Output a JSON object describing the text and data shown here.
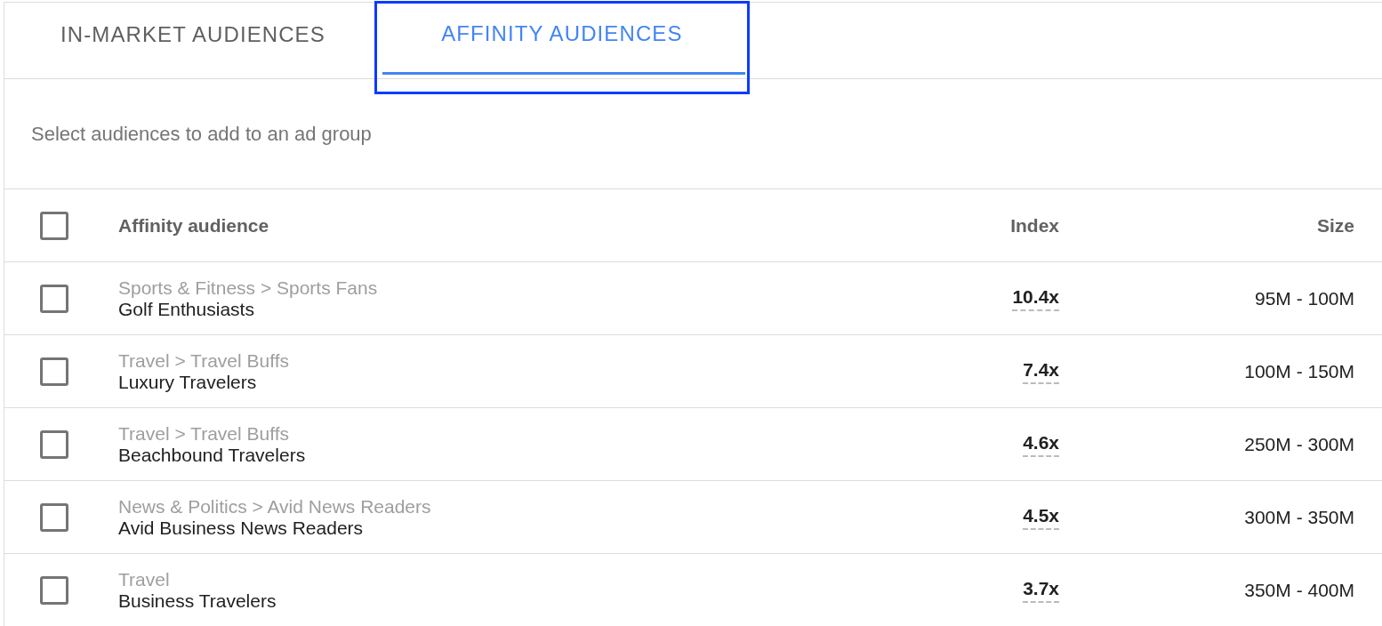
{
  "tabs": [
    {
      "label": "IN-MARKET AUDIENCES",
      "selected": false,
      "highlighted": false
    },
    {
      "label": "AFFINITY AUDIENCES",
      "selected": true,
      "highlighted": true
    }
  ],
  "subtitle": "Select audiences to add to an ad group",
  "table": {
    "select_all_checked": false,
    "columns": [
      "Affinity audience",
      "Index",
      "Size"
    ],
    "rows": [
      {
        "checked": false,
        "category": "Sports & Fitness > Sports Fans",
        "name": "Golf Enthusiasts",
        "index": "10.4x",
        "size": "95M - 100M"
      },
      {
        "checked": false,
        "category": "Travel > Travel Buffs",
        "name": "Luxury Travelers",
        "index": "7.4x",
        "size": "100M - 150M"
      },
      {
        "checked": false,
        "category": "Travel > Travel Buffs",
        "name": "Beachbound Travelers",
        "index": "4.6x",
        "size": "250M - 300M"
      },
      {
        "checked": false,
        "category": "News & Politics > Avid News Readers",
        "name": "Avid Business News Readers",
        "index": "4.5x",
        "size": "300M - 350M"
      },
      {
        "checked": false,
        "category": "Travel",
        "name": "Business Travelers",
        "index": "3.7x",
        "size": "350M - 400M"
      }
    ]
  }
}
